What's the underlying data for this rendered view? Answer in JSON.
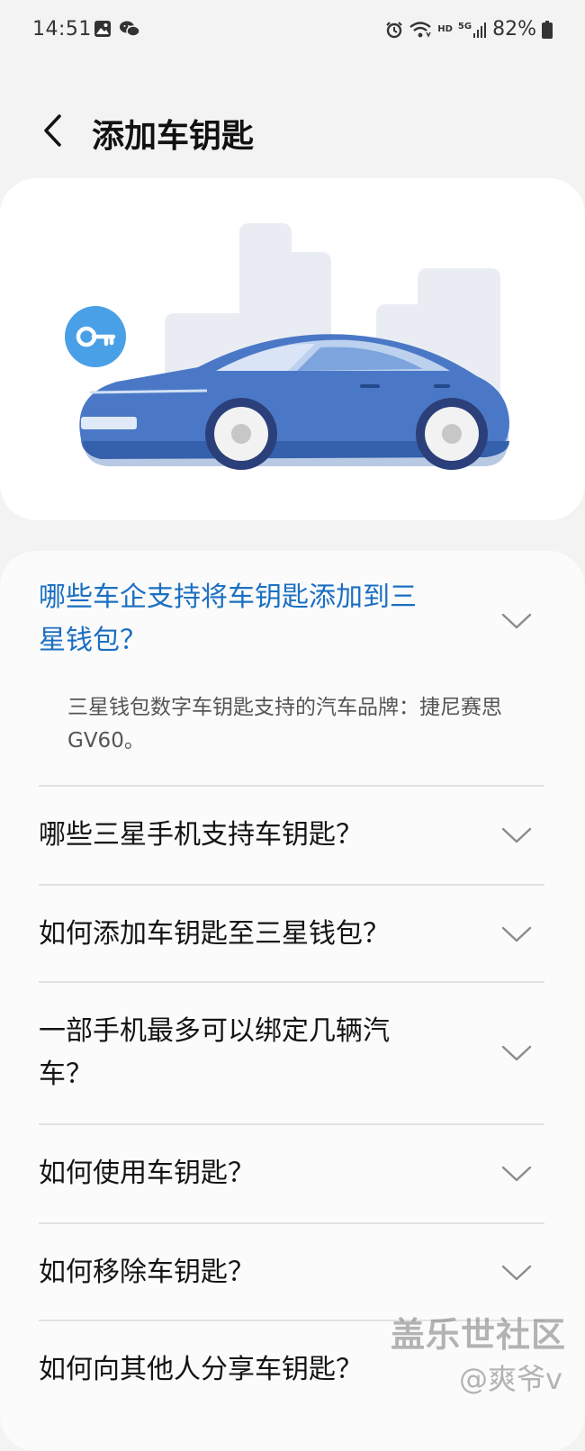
{
  "status_bar": {
    "time": "14:51",
    "battery": "82%",
    "icons_left": [
      "gallery-icon",
      "wechat-icon"
    ],
    "icons_right": [
      "alarm-icon",
      "wifi-icon",
      "hd-icon",
      "5g-signal-icon",
      "battery-icon"
    ],
    "network_hd": "HD",
    "network_5g": "5G"
  },
  "header": {
    "title": "添加车钥匙"
  },
  "hero": {
    "illustration": "car-with-key-illustration",
    "key_badge_color": "#4aa0e6",
    "car_color": "#3f6fbf"
  },
  "faq": {
    "accent_color": "#1b6fc2",
    "items": [
      {
        "question_line1": "哪些车企支持将车钥匙添加到三",
        "question_line2": "星钱包？",
        "expanded": true,
        "answer_line1": "三星钱包数字车钥匙支持的汽车品牌：捷尼赛思",
        "answer_line2": "GV60。"
      },
      {
        "question_line1": "哪些三星手机支持车钥匙？",
        "expanded": false
      },
      {
        "question_line1": "如何添加车钥匙至三星钱包？",
        "expanded": false
      },
      {
        "question_line1": "一部手机最多可以绑定几辆汽",
        "question_line2": "车？",
        "expanded": false
      },
      {
        "question_line1": "如何使用车钥匙？",
        "expanded": false
      },
      {
        "question_line1": "如何移除车钥匙？",
        "expanded": false
      },
      {
        "question_line1": "如何向其他人分享车钥匙？",
        "expanded": false
      }
    ]
  },
  "watermark": {
    "main": "盖乐世社区",
    "sub": "@爽爷v"
  }
}
